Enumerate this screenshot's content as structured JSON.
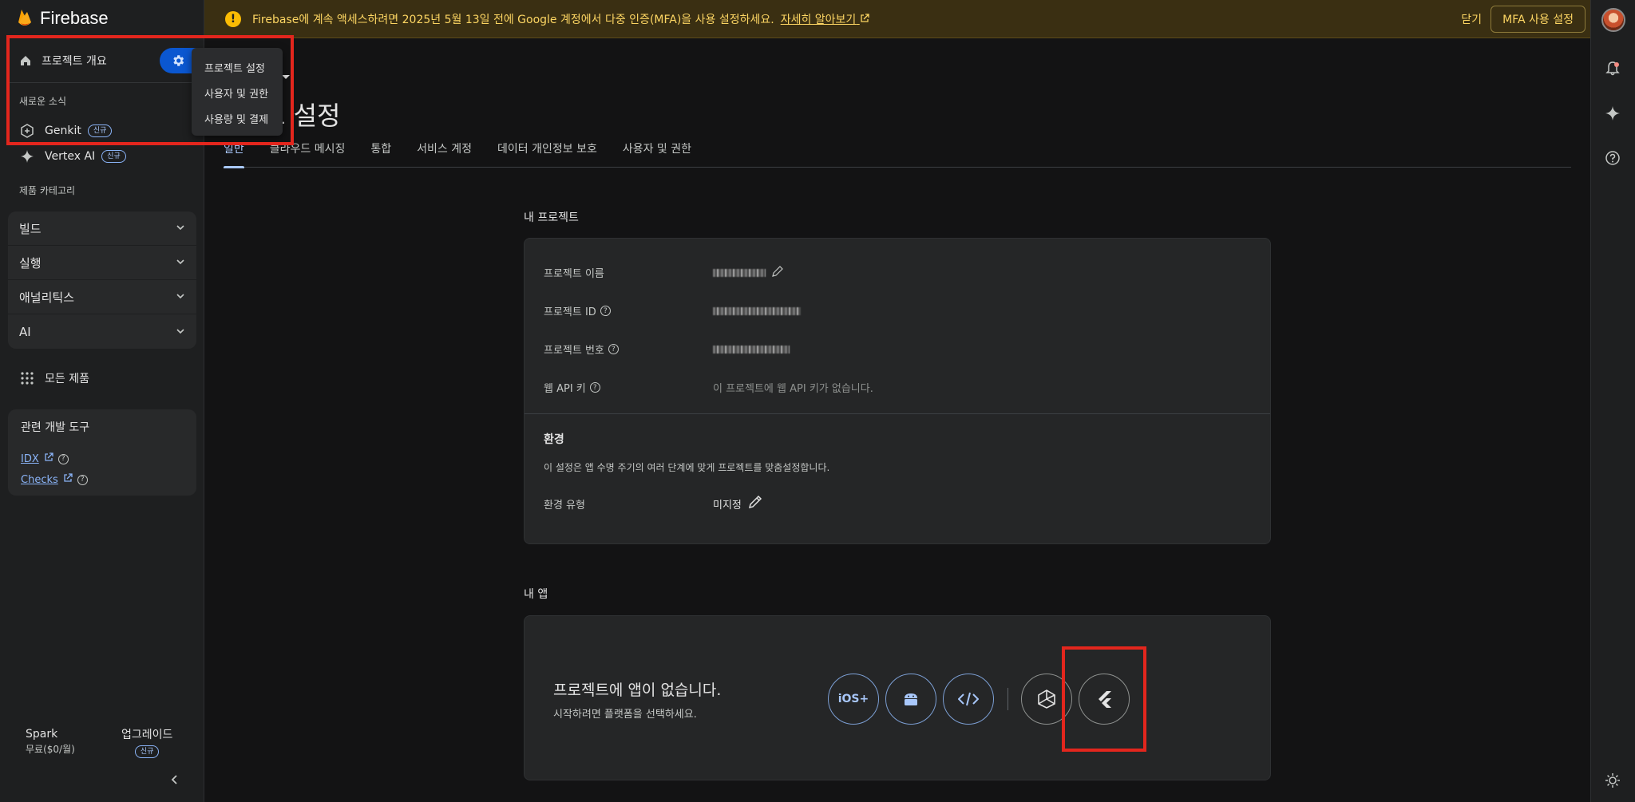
{
  "sidebar": {
    "brand": "Firebase",
    "overview": "프로젝트 개요",
    "news_label": "새로운 소식",
    "genkit": "Genkit",
    "vertex": "Vertex AI",
    "new_badge": "신규",
    "category_label": "제품 카테고리",
    "categories": [
      "빌드",
      "실행",
      "애널리틱스",
      "AI"
    ],
    "all_products": "모든 제품",
    "dev_tools_title": "관련 개발 도구",
    "idx": "IDX",
    "checks": "Checks",
    "plan_name": "Spark",
    "plan_price": "무료($0/월)",
    "upgrade": "업그레이드"
  },
  "dropdown": {
    "items": [
      "프로젝트 설정",
      "사용자 및 권한",
      "사용량 및 결제"
    ]
  },
  "banner": {
    "text": "Firebase에 계속 액세스하려면 2025년 5월 13일 전에 Google 계정에서 다중 인증(MFA)을 사용 설정하세요.",
    "link": "자세히 알아보기",
    "close": "닫기",
    "mfa_button": "MFA 사용 설정"
  },
  "main": {
    "title": "트 설정",
    "tabs": [
      "일반",
      "클라우드 메시징",
      "통합",
      "서비스 계정",
      "데이터 개인정보 보호",
      "사용자 및 권한"
    ],
    "my_project": "내 프로젝트",
    "fields": {
      "name_label": "프로젝트 이름",
      "id_label": "프로젝트 ID",
      "number_label": "프로젝트 번호",
      "api_label": "웹 API 키",
      "api_value": "이 프로젝트에 웹 API 키가 없습니다."
    },
    "env_title": "환경",
    "env_desc": "이 설정은 앱 수명 주기의 여러 단계에 맞게 프로젝트를 맞춤설정합니다.",
    "env_type_label": "환경 유형",
    "env_type_value": "미지정",
    "my_apps": "내 앱",
    "no_apps": "프로젝트에 앱이 없습니다.",
    "choose_platform": "시작하려면 플랫폼을 선택하세요.",
    "ios_label": "iOS+"
  }
}
